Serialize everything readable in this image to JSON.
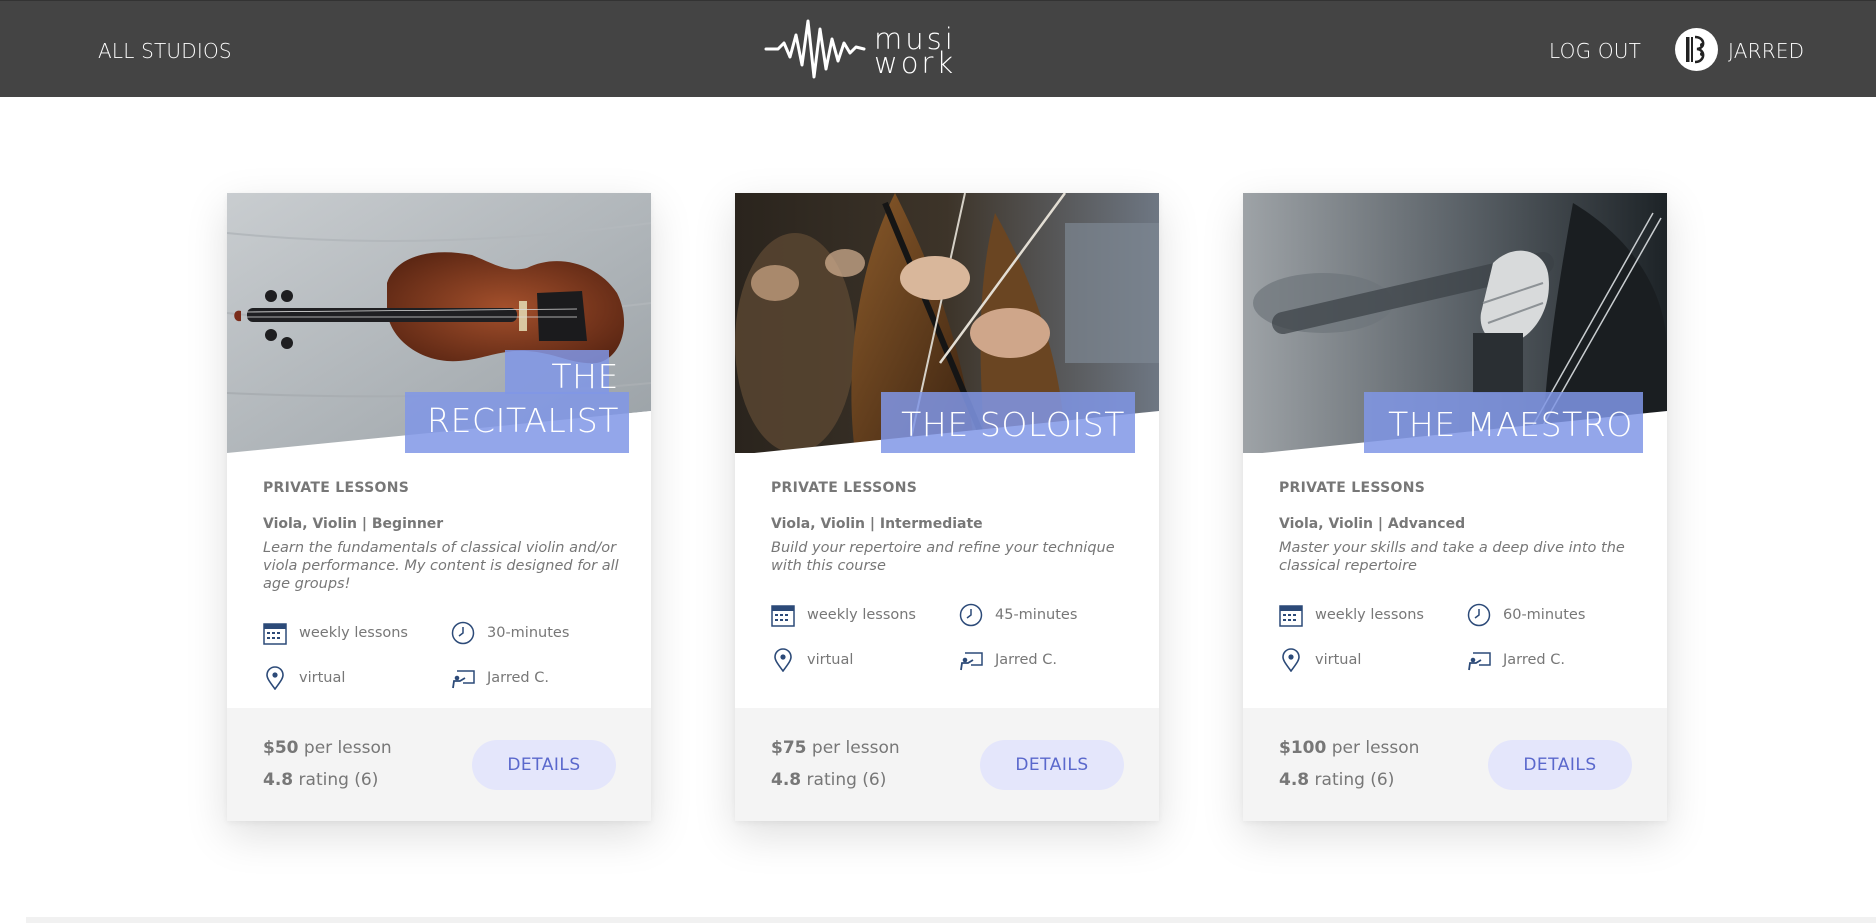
{
  "header": {
    "all_studios": "ALL STUDIOS",
    "logo_line1": "musi",
    "logo_line2": "work",
    "logout": "LOG OUT",
    "username": "JARRED",
    "bar_color": "#444444"
  },
  "cards": [
    {
      "title_line1": "THE",
      "title_line2": "RECITALIST",
      "category": "PRIVATE LESSONS",
      "level": "Viola, Violin | Beginner",
      "description": "Learn the fundamentals of classical violin and/or viola performance. My content is designed for all age groups!",
      "frequency": "weekly lessons",
      "duration": "30-minutes",
      "location": "virtual",
      "teacher": "Jarred C.",
      "price": "$50",
      "price_suffix": "per lesson",
      "rating": "4.8",
      "rating_suffix": "rating (6)",
      "button": "DETAILS"
    },
    {
      "title_line1": "THE SOLOIST",
      "category": "PRIVATE LESSONS",
      "level": "Viola, Violin | Intermediate",
      "description": "Build your repertoire and refine your technique with this course",
      "frequency": "weekly lessons",
      "duration": "45-minutes",
      "location": "virtual",
      "teacher": "Jarred C.",
      "price": "$75",
      "price_suffix": "per lesson",
      "rating": "4.8",
      "rating_suffix": "rating (6)",
      "button": "DETAILS"
    },
    {
      "title_line1": "THE MAESTRO",
      "category": "PRIVATE LESSONS",
      "level": "Viola, Violin | Advanced",
      "description": "Master your skills and take a deep dive into the classical repertoire",
      "frequency": "weekly lessons",
      "duration": "60-minutes",
      "location": "virtual",
      "teacher": "Jarred C.",
      "price": "$100",
      "price_suffix": "per lesson",
      "rating": "4.8",
      "rating_suffix": "rating (6)",
      "button": "DETAILS"
    }
  ],
  "icons": {
    "frequency": "calendar-icon",
    "duration": "clock-icon",
    "location": "location-pin-icon",
    "teacher": "teacher-board-icon"
  },
  "colors": {
    "accent": "#5a68cc",
    "button_bg": "#e4e6fb",
    "title_band": "#8096e6",
    "icon": "#2c4a78"
  }
}
